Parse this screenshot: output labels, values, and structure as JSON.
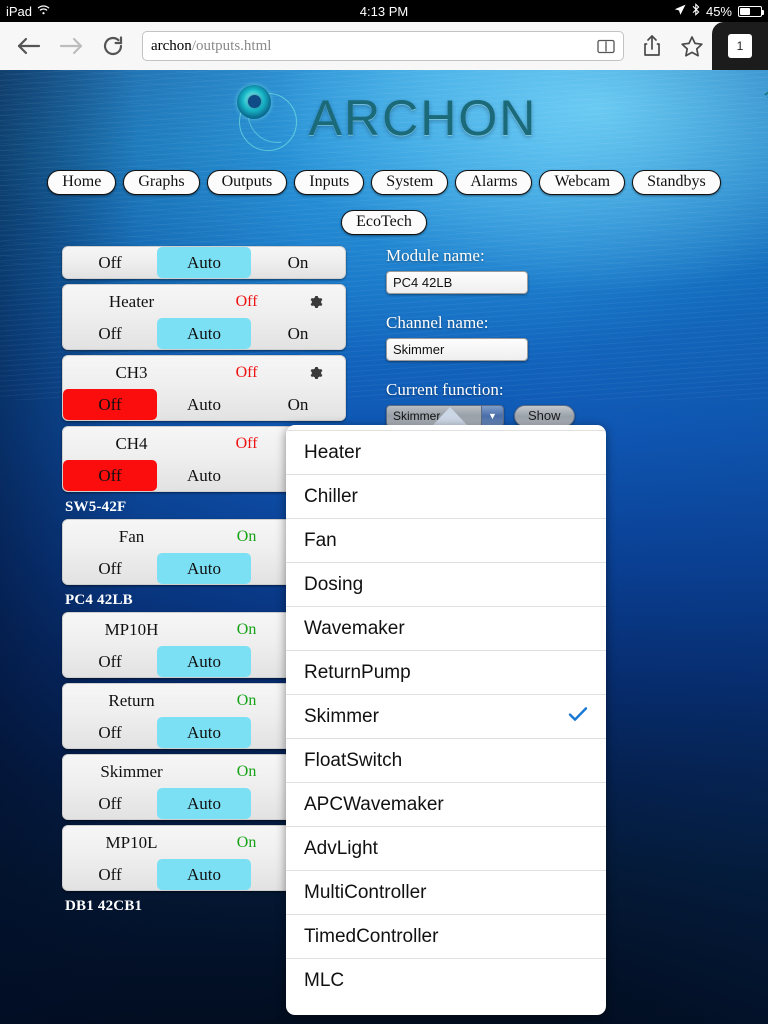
{
  "status_bar": {
    "device": "iPad",
    "wifi_icon": "wifi-icon",
    "time": "4:13 PM",
    "location_icon": "location-arrow-icon",
    "bluetooth_icon": "bluetooth-icon",
    "battery": "45%"
  },
  "browser": {
    "back_icon": "back-arrow-icon",
    "forward_icon": "forward-arrow-icon",
    "reload_icon": "reload-icon",
    "url_host": "archon",
    "url_path": "/outputs.html",
    "reader_icon": "reader-view-icon",
    "share_icon": "share-icon",
    "bookmark_icon": "bookmark-star-icon",
    "tab_count": "1"
  },
  "logo": {
    "text": "ARCHON",
    "mark_icon": "archon-swirl-icon",
    "wifi_icon": "wifi-arc-icon"
  },
  "nav": {
    "row1": [
      "Home",
      "Graphs",
      "Outputs",
      "Inputs",
      "System",
      "Alarms",
      "Webcam",
      "Standbys"
    ],
    "row2": [
      "EcoTech"
    ]
  },
  "outputs": {
    "segment_labels": {
      "off": "Off",
      "auto": "Auto",
      "on": "On"
    },
    "gear_icon": "gear-icon",
    "groups": [
      {
        "header": null,
        "channels": [
          {
            "cropped": true,
            "name": "",
            "state": "",
            "state_kind": "",
            "selected": "auto"
          },
          {
            "name": "Heater",
            "state": "Off",
            "state_kind": "off",
            "selected": "auto"
          },
          {
            "name": "CH3",
            "state": "Off",
            "state_kind": "off",
            "selected": "off"
          },
          {
            "name": "CH4",
            "state": "Off",
            "state_kind": "off",
            "selected": "off"
          }
        ]
      },
      {
        "header": "SW5-42F",
        "channels": [
          {
            "name": "Fan",
            "state": "On",
            "state_kind": "on",
            "selected": "auto"
          }
        ]
      },
      {
        "header": "PC4 42LB",
        "channels": [
          {
            "name": "MP10H",
            "state": "On",
            "state_kind": "on",
            "selected": "auto"
          },
          {
            "name": "Return",
            "state": "On",
            "state_kind": "on",
            "selected": "auto"
          },
          {
            "name": "Skimmer",
            "state": "On",
            "state_kind": "on",
            "selected": "auto"
          },
          {
            "name": "MP10L",
            "state": "On",
            "state_kind": "on",
            "selected": "auto"
          }
        ]
      },
      {
        "header": "DB1 42CB1",
        "channels": []
      }
    ]
  },
  "form": {
    "module_label": "Module name:",
    "module_value": "PC4 42LB",
    "channel_label": "Channel name:",
    "channel_value": "Skimmer",
    "function_label": "Current function:",
    "function_value": "Skimmer",
    "dropdown_arrow_icon": "chevron-down-icon",
    "show_label": "Show"
  },
  "dropdown": {
    "check_icon": "checkmark-icon",
    "selected": "Skimmer",
    "options": [
      "Heater",
      "Chiller",
      "Fan",
      "Dosing",
      "Wavemaker",
      "ReturnPump",
      "Skimmer",
      "FloatSwitch",
      "APCWavemaker",
      "AdvLight",
      "MultiController",
      "TimedController",
      "MLC"
    ]
  },
  "colors": {
    "auto_selected": "#7ce0f5",
    "off_selected": "#fb0d0d",
    "state_on": "#17a317",
    "state_off": "#ee1111",
    "check_blue": "#1878d4"
  }
}
